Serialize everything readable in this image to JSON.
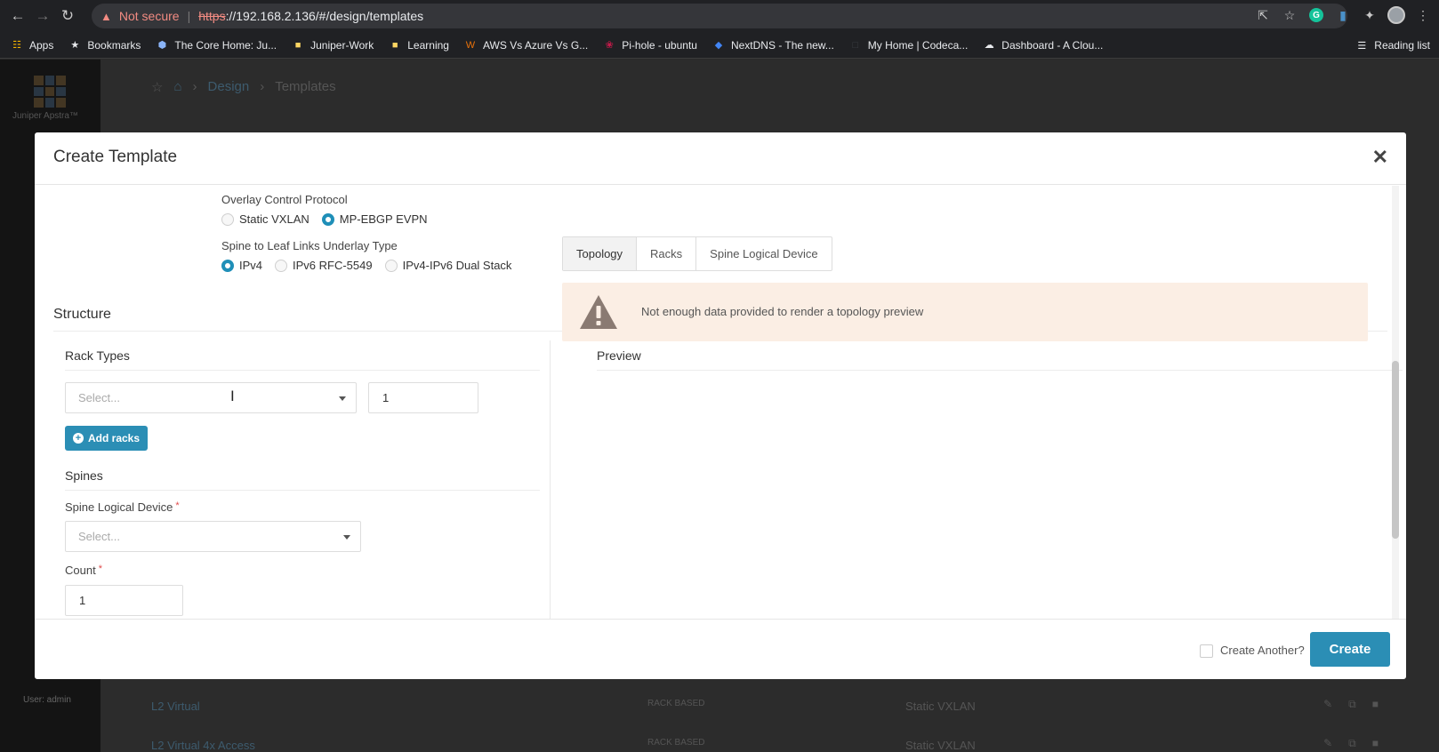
{
  "browser": {
    "security_label": "Not secure",
    "url_protocol": "https",
    "url_rest": "://192.168.2.136/#/design/templates",
    "bookmarks": [
      {
        "label": "Apps",
        "icon": "apps-grid-icon",
        "color": "#f4b400"
      },
      {
        "label": "Bookmarks",
        "icon": "star-icon",
        "color": "#e8eaed"
      },
      {
        "label": "The Core Home: Ju...",
        "icon": "hexagon-icon",
        "color": "#8ab4f8"
      },
      {
        "label": "Juniper-Work",
        "icon": "folder-icon",
        "color": "#fdd663"
      },
      {
        "label": "Learning",
        "icon": "folder-icon",
        "color": "#fdd663"
      },
      {
        "label": "AWS Vs Azure Vs G...",
        "icon": "brand-w-icon",
        "color": "#e8710a"
      },
      {
        "label": "Pi-hole - ubuntu",
        "icon": "raspberry-icon",
        "color": "#c51a4a"
      },
      {
        "label": "NextDNS - The new...",
        "icon": "shield-icon",
        "color": "#4285f4"
      },
      {
        "label": "My Home | Codeca...",
        "icon": "page-icon",
        "color": "#3c4043"
      },
      {
        "label": "Dashboard - A Clou...",
        "icon": "cloud-icon",
        "color": "#e8eaed"
      }
    ],
    "reading_list": "Reading list"
  },
  "app": {
    "brand": "Juniper Apstra™",
    "user": "User: admin",
    "breadcrumb": {
      "section": "Design",
      "page": "Templates"
    },
    "rows": [
      {
        "name": "L2 Virtual",
        "type": "RACK BASED",
        "protocol": "Static VXLAN"
      },
      {
        "name": "L2 Virtual 4x Access",
        "type": "RACK BASED",
        "protocol": "Static VXLAN"
      }
    ]
  },
  "modal": {
    "title": "Create Template",
    "overlay": {
      "label": "Overlay Control Protocol",
      "options": [
        "Static VXLAN",
        "MP-EBGP EVPN"
      ],
      "selected": "MP-EBGP EVPN"
    },
    "underlay": {
      "label": "Spine to Leaf Links Underlay Type",
      "options": [
        "IPv4",
        "IPv6 RFC-5549",
        "IPv4-IPv6 Dual Stack"
      ],
      "selected": "IPv4"
    },
    "structure_title": "Structure",
    "rack_types": {
      "title": "Rack Types",
      "select_placeholder": "Select...",
      "count": "1",
      "add_label": "Add racks"
    },
    "spines": {
      "title": "Spines",
      "device_label": "Spine Logical Device",
      "device_placeholder": "Select...",
      "count_label": "Count",
      "count_value": "1",
      "required_mark": "*"
    },
    "preview": {
      "title": "Preview",
      "tabs": [
        "Topology",
        "Racks",
        "Spine Logical Device"
      ],
      "active_tab": "Topology",
      "alert": "Not enough data provided to render a topology preview"
    },
    "footer": {
      "create_another": "Create Another?",
      "create": "Create"
    }
  },
  "colors": {
    "accent": "#2b8eb5",
    "alert_bg": "#fbeee4",
    "warning_icon": "#8a7a72"
  }
}
